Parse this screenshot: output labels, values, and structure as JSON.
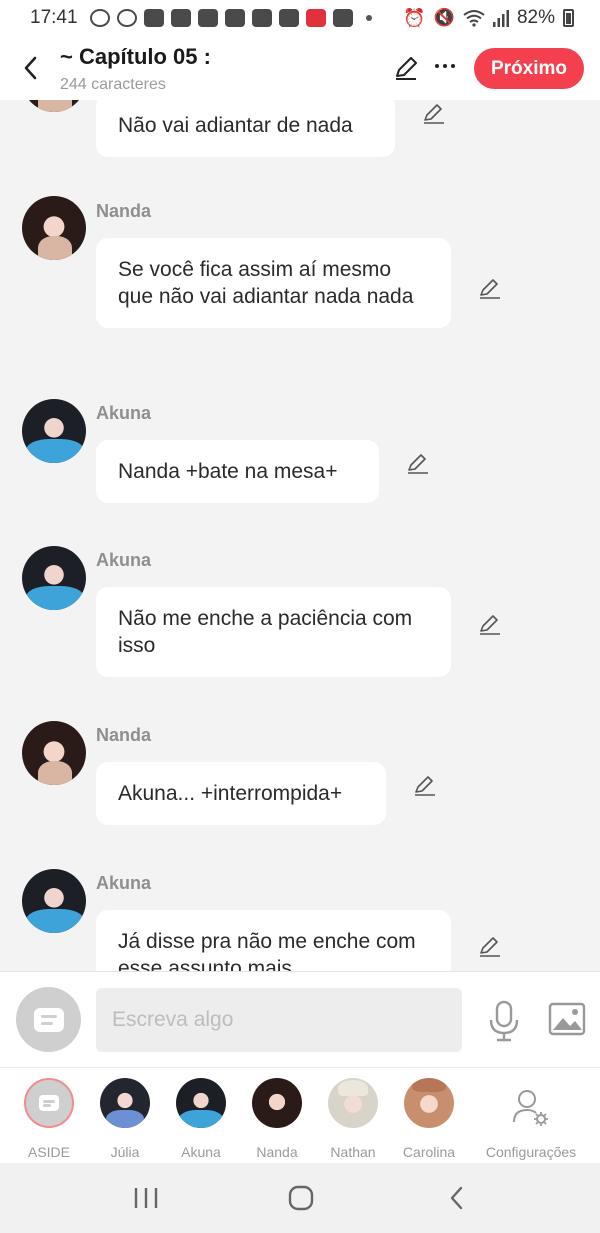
{
  "status_bar": {
    "time": "17:41",
    "battery": "82%"
  },
  "header": {
    "title": "~ Capítulo 05 :",
    "subtitle": "244 caracteres",
    "next_label": "Próximo"
  },
  "messages": [
    {
      "sender": "",
      "text": "Não vai adiantar de nada",
      "avatar": "nanda"
    },
    {
      "sender": "Nanda",
      "text": "Se você fica assim aí mesmo que não vai adiantar nada nada",
      "avatar": "nanda"
    },
    {
      "sender": "Akuna",
      "text": "Nanda +bate na mesa+",
      "avatar": "akuna"
    },
    {
      "sender": "Akuna",
      "text": "Não me enche a paciência com isso",
      "avatar": "akuna"
    },
    {
      "sender": "Nanda",
      "text": "Akuna... +interrompida+",
      "avatar": "nanda"
    },
    {
      "sender": "Akuna",
      "text": "Já disse pra não me enche com esse assunto mais",
      "avatar": "akuna"
    }
  ],
  "composer": {
    "placeholder": "Escreva algo"
  },
  "tabs": [
    {
      "label": "ASIDE"
    },
    {
      "label": "Júlia"
    },
    {
      "label": "Akuna"
    },
    {
      "label": "Nanda"
    },
    {
      "label": "Nathan"
    },
    {
      "label": "Carolina"
    },
    {
      "label": "Configurações"
    }
  ],
  "colors": {
    "accent": "#f43f4f",
    "background": "#f3f3f3",
    "bubble": "#ffffff"
  },
  "icons": [
    "back-icon",
    "edit-icon",
    "more-icon",
    "mic-icon",
    "image-icon",
    "settings-user-icon",
    "recent-apps-icon",
    "home-icon",
    "nav-back-icon"
  ]
}
